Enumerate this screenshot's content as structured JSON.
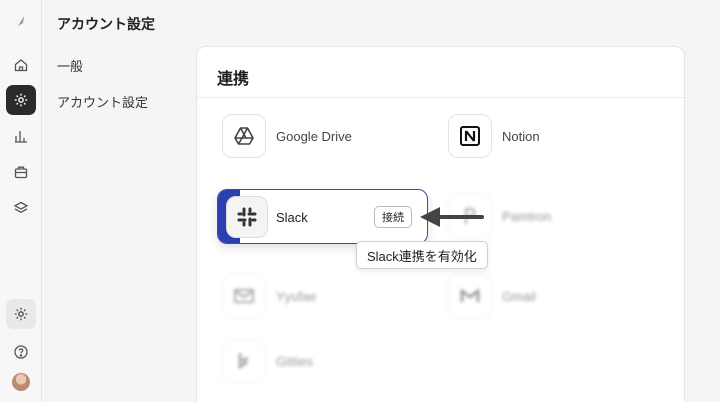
{
  "rail": {
    "icons": [
      "logo-icon",
      "home-icon",
      "settings-icon",
      "chart-icon",
      "briefcase-icon",
      "layers-icon",
      "settings-bottom-icon",
      "help-icon"
    ]
  },
  "nav": {
    "title": "アカウント設定",
    "items": [
      {
        "label": "一般"
      },
      {
        "label": "アカウント設定"
      }
    ]
  },
  "card": {
    "title": "連携",
    "integrations": [
      {
        "name": "Google Drive",
        "icon": "google-drive-icon"
      },
      {
        "name": "Notion",
        "icon": "notion-icon"
      },
      {
        "name": "Slack",
        "icon": "slack-icon",
        "action": "接続"
      },
      {
        "name": "Pamtron",
        "icon": "pamtron-icon"
      },
      {
        "name": "Yyufae",
        "icon": "mail-icon"
      },
      {
        "name": "Gmail",
        "icon": "gmail-icon"
      },
      {
        "name": "Gitties",
        "icon": "bing-icon"
      }
    ]
  },
  "tooltip": {
    "text": "Slack連携を有効化"
  },
  "colors": {
    "accent": "#2b3fb0",
    "active_rail": "#2b2b2b"
  }
}
